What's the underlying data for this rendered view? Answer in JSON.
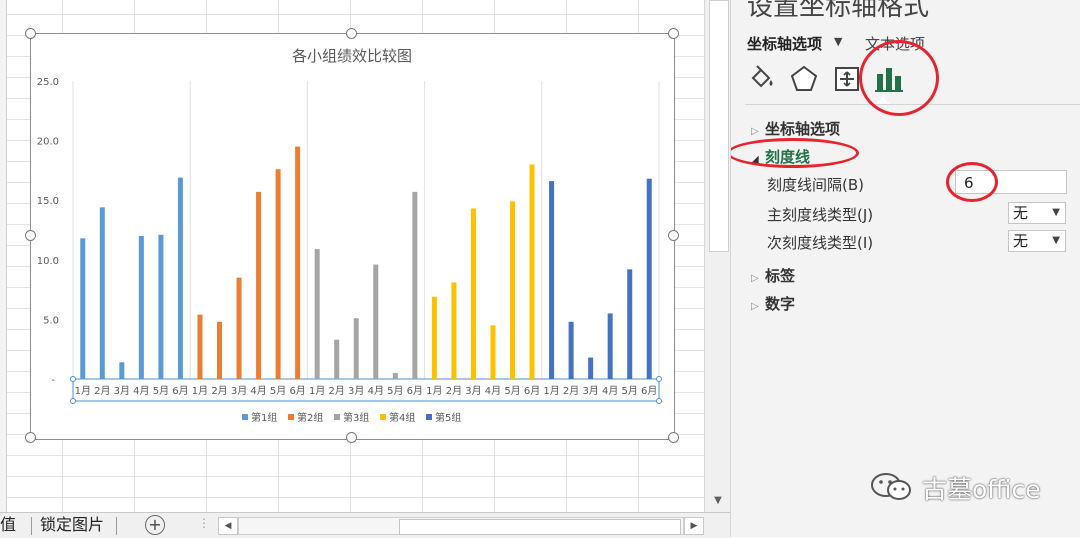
{
  "pane": {
    "title": "设置坐标轴格式",
    "tab_axis_options": "坐标轴选项",
    "tab_text_options": "文本选项",
    "icons": [
      "fill-line-icon",
      "effects-pentagon-icon",
      "size-properties-icon",
      "axis-options-bar-chart-icon"
    ],
    "sections": {
      "axis_options": "坐标轴选项",
      "tick_marks": "刻度线",
      "labels": "标签",
      "number": "数字"
    },
    "tick_interval_label": "刻度线间隔(B)",
    "tick_interval_value": "6",
    "major_tick_label": "主刻度线类型(J)",
    "major_tick_value": "无",
    "minor_tick_label": "次刻度线类型(I)",
    "minor_tick_value": "无"
  },
  "sheet_tabs": {
    "tab1": "值",
    "tab2": "锁定图片"
  },
  "watermark": "古墓office",
  "colors": {
    "group1": "#5B9BD5",
    "group2": "#ED7D31",
    "group3": "#A5A5A5",
    "group4": "#FFC000",
    "group5": "#4472C4",
    "annotation_red": "#E8232D",
    "accent_green": "#217346"
  },
  "chart_data": {
    "type": "bar",
    "title": "各小组绩效比较图",
    "ylim": [
      0,
      25
    ],
    "yticks": [
      "-",
      "5.0",
      "10.0",
      "15.0",
      "20.0",
      "25.0"
    ],
    "categories": [
      "1月",
      "2月",
      "3月",
      "4月",
      "5月",
      "6月"
    ],
    "legend_position": "bottom",
    "grid": "vertical",
    "series": [
      {
        "name": "第1组",
        "values": [
          11.8,
          14.4,
          1.4,
          12.0,
          12.1,
          16.9
        ]
      },
      {
        "name": "第2组",
        "values": [
          5.4,
          4.8,
          8.5,
          15.7,
          17.6,
          19.5
        ]
      },
      {
        "name": "第3组",
        "values": [
          10.9,
          3.3,
          5.1,
          9.6,
          0.5,
          15.7
        ]
      },
      {
        "name": "第4组",
        "values": [
          6.9,
          8.1,
          14.3,
          4.5,
          14.9,
          18.0
        ]
      },
      {
        "name": "第5组",
        "values": [
          16.6,
          4.8,
          1.8,
          5.5,
          9.2,
          16.8
        ]
      }
    ]
  }
}
